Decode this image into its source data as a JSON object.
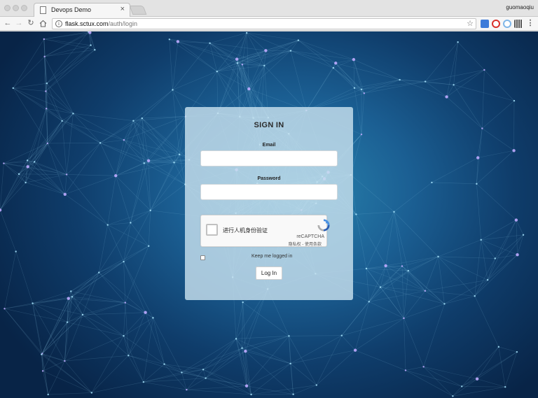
{
  "browser": {
    "tab_title": "Devops Demo",
    "tab_close": "×",
    "profile_name": "guomaoqiu",
    "url_host": "flask.sctux.com",
    "url_path": "/auth/login",
    "icons": {
      "back": "back-arrow-icon",
      "forward": "forward-arrow-icon",
      "reload": "reload-icon",
      "home": "home-icon",
      "info": "info-icon",
      "star": "star-icon",
      "menu": "menu-dots-icon"
    }
  },
  "login": {
    "title": "SIGN IN",
    "email_label": "Email",
    "email_value": "",
    "password_label": "Password",
    "password_value": "",
    "remember_label": "Keep me logged in",
    "remember_checked": false,
    "submit_label": "Log In"
  },
  "captcha": {
    "label": "进行人机身份验证",
    "brand": "reCAPTCHA",
    "links": "隐私权 - 使用条款"
  },
  "colors": {
    "background_center": "#2a86b0",
    "background_edge": "#082447",
    "card": "#c8e1ee",
    "captcha_blue": "#4a90e2"
  }
}
